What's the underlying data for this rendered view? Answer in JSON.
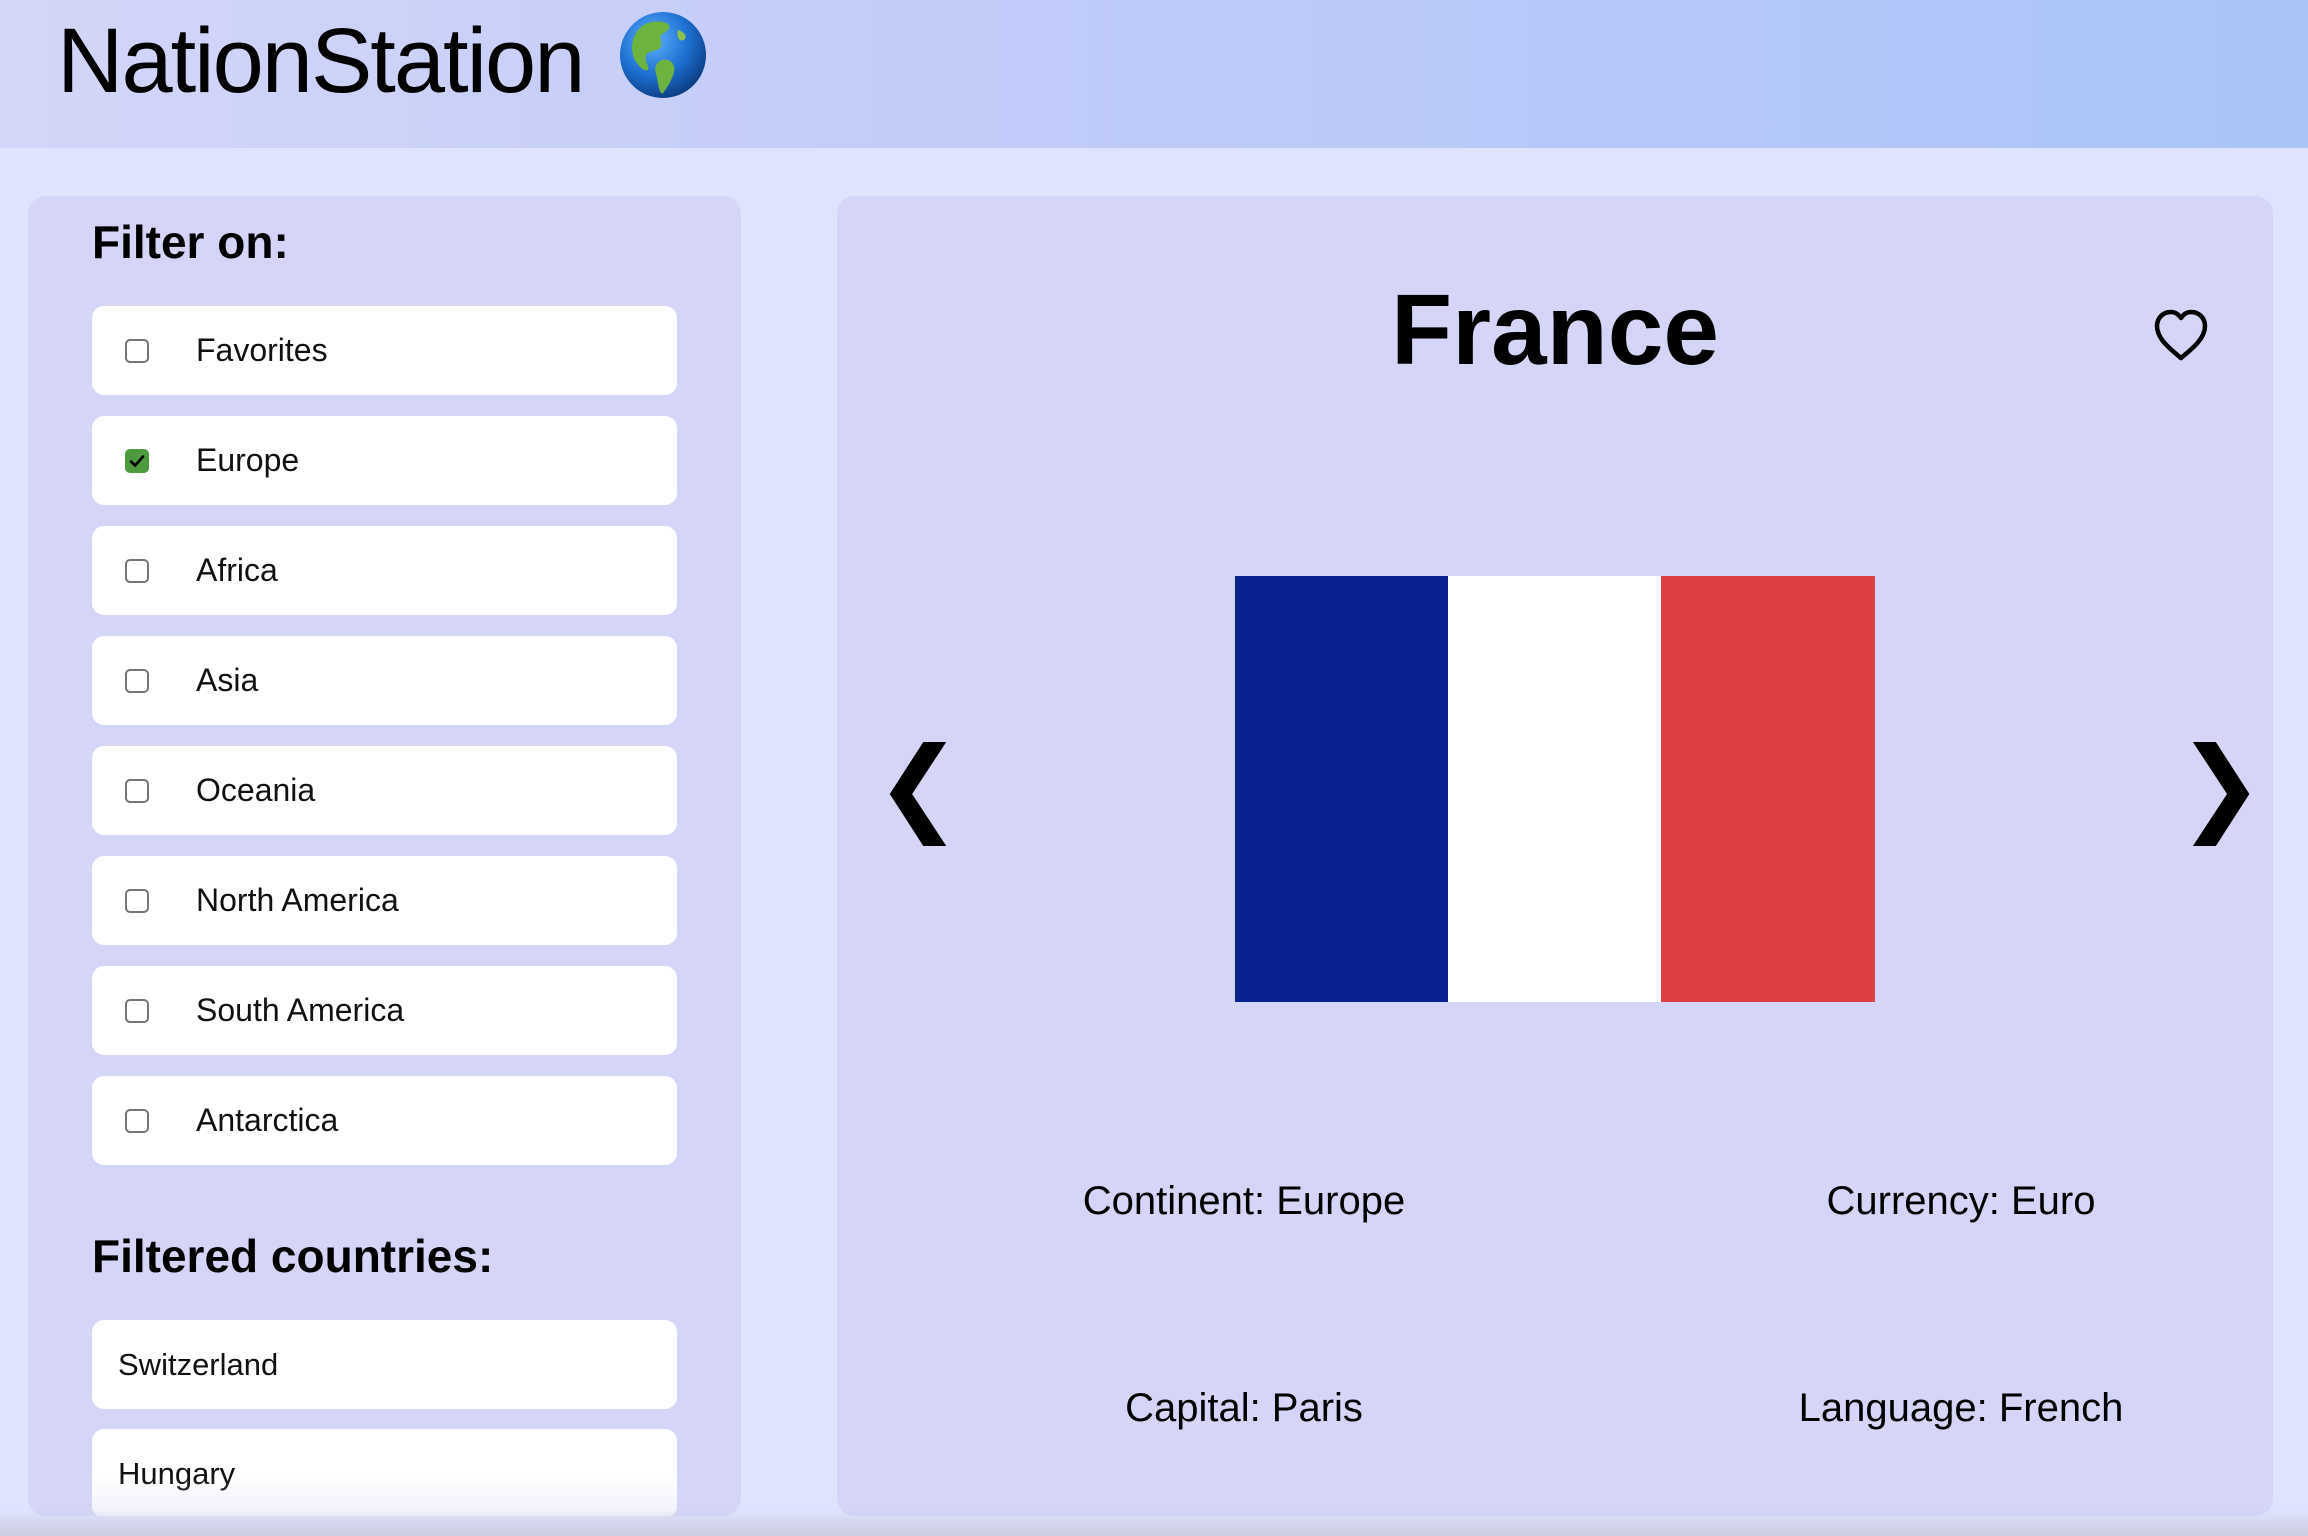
{
  "app": {
    "title": "NationStation",
    "logo_icon": "globe-americas-icon"
  },
  "sidebar": {
    "filter_heading": "Filter on:",
    "filters": [
      {
        "label": "Favorites",
        "checked": false
      },
      {
        "label": "Europe",
        "checked": true
      },
      {
        "label": "Africa",
        "checked": false
      },
      {
        "label": "Asia",
        "checked": false
      },
      {
        "label": "Oceania",
        "checked": false
      },
      {
        "label": "North America",
        "checked": false
      },
      {
        "label": "South America",
        "checked": false
      },
      {
        "label": "Antarctica",
        "checked": false
      }
    ],
    "countries_heading": "Filtered countries:",
    "countries": [
      "Switzerland",
      "Hungary"
    ]
  },
  "country": {
    "name": "France",
    "favorite_icon": "heart-outline-icon",
    "prev_icon": "chevron-left-icon",
    "next_icon": "chevron-right-icon",
    "prev_label": "❮",
    "next_label": "❯",
    "flag_colors": [
      "#0a2290",
      "#ffffff",
      "#dc4042"
    ],
    "continent": "Continent: Europe",
    "currency": "Currency: Euro",
    "capital": "Capital: Paris",
    "language": "Language: French"
  },
  "colors": {
    "header_gradient_start": "#d3d6f8",
    "header_gradient_end": "#aac4f7",
    "panel_background": "#d4d5f7",
    "page_background": "#dfe3fd",
    "checkbox_checked": "#4e9a3e"
  }
}
